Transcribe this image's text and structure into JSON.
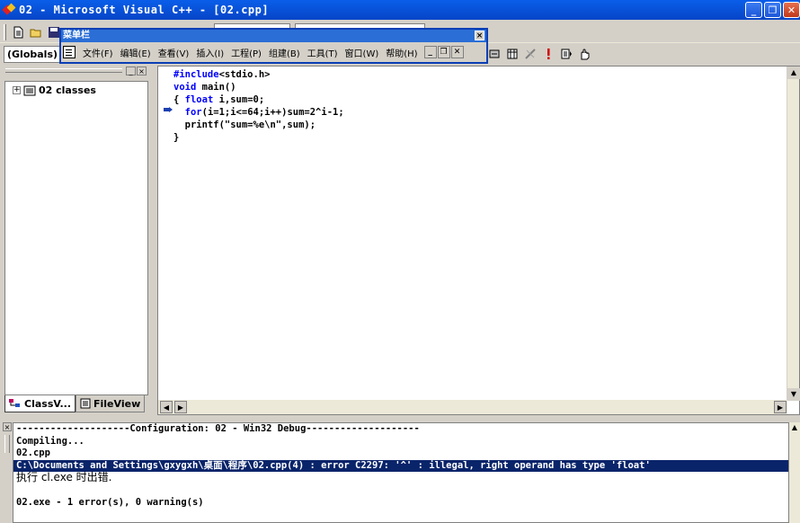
{
  "window": {
    "title": "02 - Microsoft Visual C++ - [02.cpp]",
    "buttons": {
      "minimize": "_",
      "maximize": "❐",
      "close": "✕"
    }
  },
  "toolbar": {
    "scope_combo": "(Globals)",
    "icons": [
      "new-file-icon",
      "open-folder-icon",
      "save-icon",
      "compile-icon",
      "build-icon",
      "stop-build-icon",
      "execute-icon",
      "go-icon",
      "breakpoint-hand-icon"
    ]
  },
  "menubar": {
    "title": "菜单栏",
    "items": [
      "文件(F)",
      "编辑(E)",
      "查看(V)",
      "插入(I)",
      "工程(P)",
      "组建(B)",
      "工具(T)",
      "窗口(W)",
      "帮助(H)"
    ],
    "mdi": [
      "_",
      "❐",
      "✕"
    ]
  },
  "workspace": {
    "tree_root": "02 classes",
    "tabs": [
      "ClassV...",
      "FileView"
    ]
  },
  "editor": {
    "lines": [
      {
        "kw": "#include",
        "rest": "<stdio.h>"
      },
      {
        "kw": "void",
        "rest": " main()"
      },
      {
        "kw": "",
        "rest": "{ ",
        "kw2": "float",
        "rest2": " i,sum=0;"
      },
      {
        "kw": "",
        "rest": "  ",
        "kw2": "for",
        "rest2": "(i=1;i<=64;i++)sum=2^i-1;"
      },
      {
        "kw": "",
        "rest": "  printf(\"sum=%e\\n\",sum);"
      },
      {
        "kw": "",
        "rest": "}"
      }
    ]
  },
  "output": {
    "lines": [
      "--------------------Configuration: 02 - Win32 Debug--------------------",
      "Compiling...",
      "02.cpp",
      "C:\\Documents and Settings\\gxygxh\\桌面\\程序\\02.cpp(4) : error C2297: '^' : illegal, right operand has type 'float'",
      "执行 cl.exe 时出错.",
      "",
      "02.exe - 1 error(s), 0 warning(s)"
    ]
  },
  "colors": {
    "titlebar": "#0645c7",
    "selection": "#0a246a",
    "keyword": "#0000ff"
  }
}
